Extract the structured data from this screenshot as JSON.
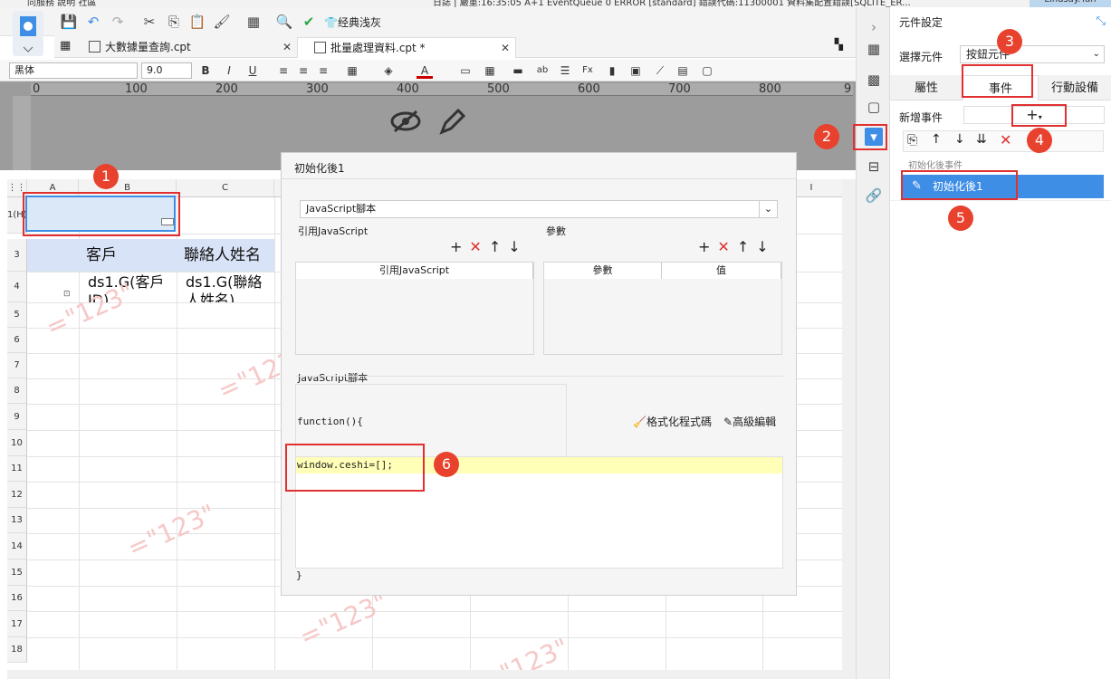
{
  "topbar": {
    "left_menu": "同服務  說明  社區",
    "status_text": "日誌 | 嚴重:16:35:05 A+1 EventQueue 0 ERROR [standard] 錯誤代碼:11300001 資料集配置錯誤[SQLITE_ER...",
    "user": "Lindsay.Yan"
  },
  "toolbar": {
    "style_label": "经典浅灰"
  },
  "tabs": [
    {
      "label": "大數據量查詢.cpt"
    },
    {
      "label": "批量處理資料.cpt *"
    }
  ],
  "format": {
    "font": "黑体",
    "size": "9.0"
  },
  "ruler": {
    "marks": [
      "0",
      "100",
      "200",
      "300",
      "400",
      "500",
      "600",
      "700",
      "800",
      "9"
    ]
  },
  "grid": {
    "columns": [
      "A",
      "B",
      "C",
      "I"
    ],
    "rows": [
      "1(H)",
      "3",
      "4",
      "5",
      "6",
      "7",
      "8",
      "9",
      "10",
      "11",
      "12",
      "13",
      "14",
      "15",
      "16",
      "17",
      "18"
    ],
    "header_cells": [
      "客戶",
      "聯絡人姓名"
    ],
    "data_cells": [
      "ds1.G(客戶ID)",
      "ds1.G(聯絡人姓名)"
    ],
    "watermark": "=\"123\""
  },
  "dialog": {
    "title": "初始化後1",
    "type_select": "JavaScript腳本",
    "ref_label": "引用JavaScript",
    "params_label": "參數",
    "ref_col": "引用JavaScript",
    "param_col": "參數",
    "value_col": "值",
    "script_label": "JavaScript腳本",
    "func_open": "function(){",
    "code_line": "window.ceshi=[];",
    "func_close": "}",
    "format_btn": "格式化程式碼",
    "advanced_btn": "高級編輯"
  },
  "panel": {
    "title": "元件設定",
    "select_label": "選擇元件",
    "select_value": "按鈕元件",
    "tabs": [
      "屬性",
      "事件",
      "行動設備"
    ],
    "add_event_label": "新增事件",
    "event_group": "初始化後事件",
    "event_item": "初始化後1"
  },
  "badges": [
    "1",
    "2",
    "3",
    "4",
    "5",
    "6"
  ],
  "colors": {
    "accent": "#3e8ee6",
    "highlight": "#e03030",
    "selected": "#3e8ee6"
  }
}
